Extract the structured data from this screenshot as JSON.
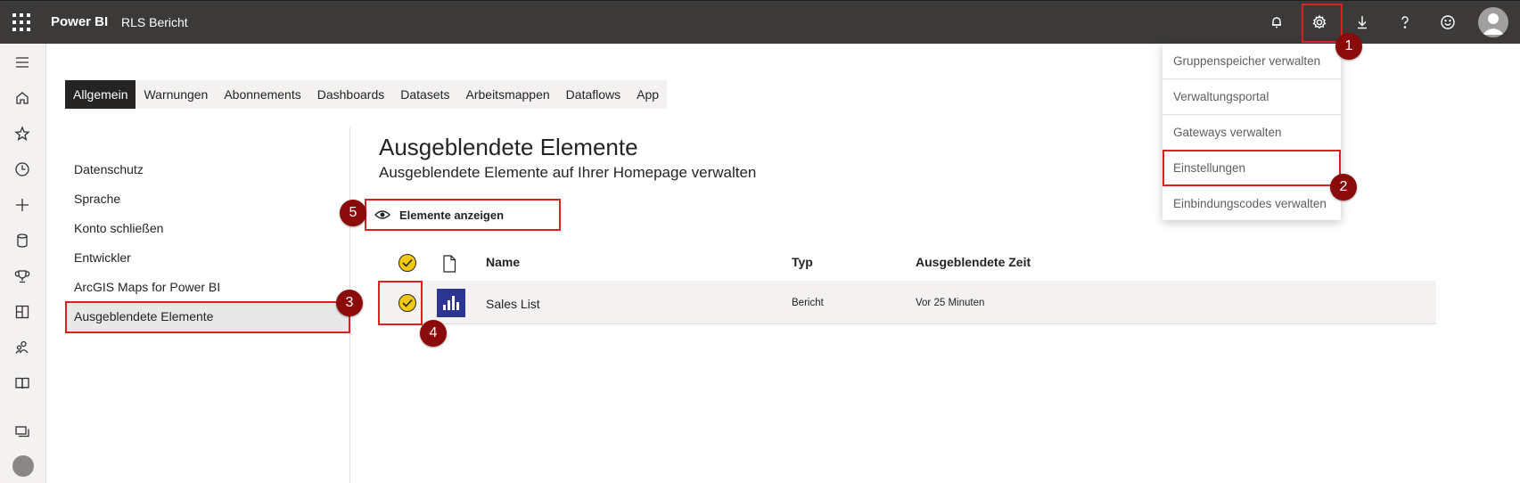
{
  "header": {
    "brand": "Power BI",
    "report_name": "RLS Bericht",
    "icons": [
      "waffle-icon",
      "bell-icon",
      "gear-icon",
      "download-icon",
      "help-icon",
      "smiley-icon",
      "user-avatar"
    ]
  },
  "left_rail": {
    "icons": [
      "hamburger-icon",
      "home-icon",
      "star-icon",
      "clock-icon",
      "plus-icon",
      "database-icon",
      "trophy-icon",
      "dashboard-icon",
      "people-icon",
      "book-icon",
      "workspaces-icon",
      "account-icon"
    ]
  },
  "tabs": [
    {
      "label": "Allgemein",
      "active": true
    },
    {
      "label": "Warnungen",
      "active": false
    },
    {
      "label": "Abonnements",
      "active": false
    },
    {
      "label": "Dashboards",
      "active": false
    },
    {
      "label": "Datasets",
      "active": false
    },
    {
      "label": "Arbeitsmappen",
      "active": false
    },
    {
      "label": "Dataflows",
      "active": false
    },
    {
      "label": "App",
      "active": false
    }
  ],
  "settings_nav": [
    {
      "label": "Datenschutz"
    },
    {
      "label": "Sprache"
    },
    {
      "label": "Konto schließen"
    },
    {
      "label": "Entwickler"
    },
    {
      "label": "ArcGIS Maps for Power BI"
    },
    {
      "label": "Ausgeblendete Elemente",
      "selected": true
    }
  ],
  "main": {
    "title": "Ausgeblendete Elemente",
    "subtitle": "Ausgeblendete Elemente auf Ihrer Homepage verwalten",
    "show_button": "Elemente anzeigen",
    "columns": {
      "name": "Name",
      "type": "Typ",
      "hidden_time": "Ausgeblendete Zeit"
    },
    "rows": [
      {
        "name": "Sales List",
        "type": "Bericht",
        "hidden_time": "Vor 25 Minuten",
        "checked": true
      }
    ]
  },
  "menu": {
    "items": [
      "Gruppenspeicher verwalten",
      "Verwaltungsportal",
      "Gateways verwalten",
      "Einstellungen",
      "Einbindungscodes verwalten"
    ]
  },
  "annotations": [
    "1",
    "2",
    "3",
    "4",
    "5"
  ],
  "colors": {
    "topbar": "#3b3a39",
    "accent_yellow": "#f2c811",
    "annotation_red": "#e02020",
    "badge": "#8b0a0a",
    "report_icon": "#2c3592"
  }
}
